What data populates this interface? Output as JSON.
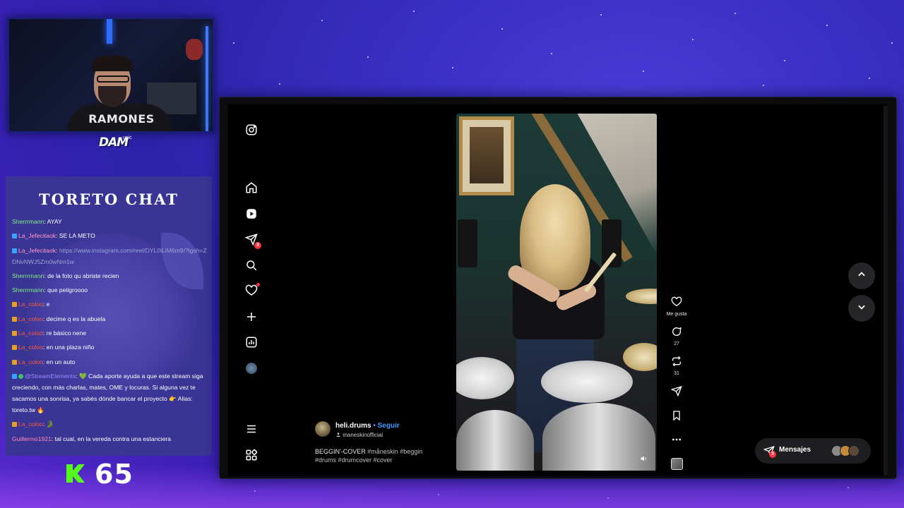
{
  "stream": {
    "webcam": {
      "shirt_text": "RAMONES"
    },
    "logo": {
      "main": "DAM",
      "sub": "usic"
    },
    "chat": {
      "title": "TORETO CHAT",
      "messages": [
        {
          "user": "Sherrrmann",
          "text": ": AYAY",
          "user_color": "#7CF57C",
          "badges": []
        },
        {
          "user": "La_Jefecitaok",
          "text": ": SE LA METO",
          "user_color": "#FF9CC8",
          "badges": [
            "blue"
          ]
        },
        {
          "user": "La_Jefecitaok",
          "text": ": ",
          "link": "https://www.instagram.com/reel/DYL0iLiM6m9/?igsh=ZDNvNWJ5Zm0wNm1w",
          "user_color": "#FF9CC8",
          "badges": [
            "blue"
          ]
        },
        {
          "user": "Sherrrmann",
          "text": ": de la foto qu abriste recien",
          "user_color": "#7CF57C",
          "badges": []
        },
        {
          "user": "Sherrrmann",
          "text": ": que peligroooo",
          "user_color": "#7CF57C",
          "badges": []
        },
        {
          "user": "La_coloo",
          "text": ": e",
          "user_color": "#FF5A3C",
          "badges": [
            "orange"
          ]
        },
        {
          "user": "La_coloo",
          "text": ": decime q es la abuela",
          "user_color": "#FF5A3C",
          "badges": [
            "orange"
          ]
        },
        {
          "user": "La_coloo",
          "text": ": re básico nene",
          "user_color": "#FF5A3C",
          "badges": [
            "orange"
          ]
        },
        {
          "user": "La_coloo",
          "text": ": en una plaza niño",
          "user_color": "#FF5A3C",
          "badges": [
            "orange"
          ]
        },
        {
          "user": "La_coloo",
          "text": ": en un auto",
          "user_color": "#FF5A3C",
          "badges": [
            "orange"
          ]
        },
        {
          "user": "@StreamElements",
          "text": ": 💚 Cada aporte ayuda a que este stream siga creciendo, con más charlas, mates, OME y locuras. Si alguna vez te sacamos una sonrisa, ya sabés dónde bancar el proyecto 👉 Alias: toreto.tw 🔥",
          "user_color": "#9C8CFF",
          "badges": [
            "blue",
            "green"
          ]
        },
        {
          "user": "La_coloo",
          "text": ": 🐊",
          "user_color": "#FF5A3C",
          "badges": [
            "orange"
          ]
        },
        {
          "user": "Guillermo1921",
          "text": ": tal cual, en la vereda contra una estanciera",
          "user_color": "#FF8AB4",
          "badges": []
        }
      ]
    },
    "kick": {
      "count": "65",
      "color": "#53FC18"
    }
  },
  "instagram": {
    "sidebar": {
      "logo_icon": "instagram-icon",
      "items": [
        {
          "name": "home",
          "icon": "home-icon"
        },
        {
          "name": "reels",
          "icon": "reels-icon"
        },
        {
          "name": "messages",
          "icon": "direct-icon",
          "badge": "3"
        },
        {
          "name": "search",
          "icon": "search-icon"
        },
        {
          "name": "notifications",
          "icon": "heart-icon"
        },
        {
          "name": "create",
          "icon": "plus-icon"
        },
        {
          "name": "dashboard",
          "icon": "chart-icon"
        },
        {
          "name": "profile",
          "icon": "profile-avatar"
        }
      ],
      "more_icon": "menu-icon",
      "also_from_meta_icon": "grid-icon"
    },
    "post": {
      "username": "heli.drums",
      "separator": " • ",
      "follow_label": "Seguir",
      "audio": "maneskinofficial",
      "caption_title": "BEGGIN'-COVER",
      "caption_tags": "#måneskin #beggin #drums #drumcover #cover"
    },
    "actions": {
      "like_label": "Me gusta",
      "comments": "27",
      "reposts": "31"
    },
    "messages_pill": {
      "label": "Mensajes",
      "count": "3"
    },
    "accent": "#3D9AFF",
    "badge_color": "#FF3040"
  }
}
